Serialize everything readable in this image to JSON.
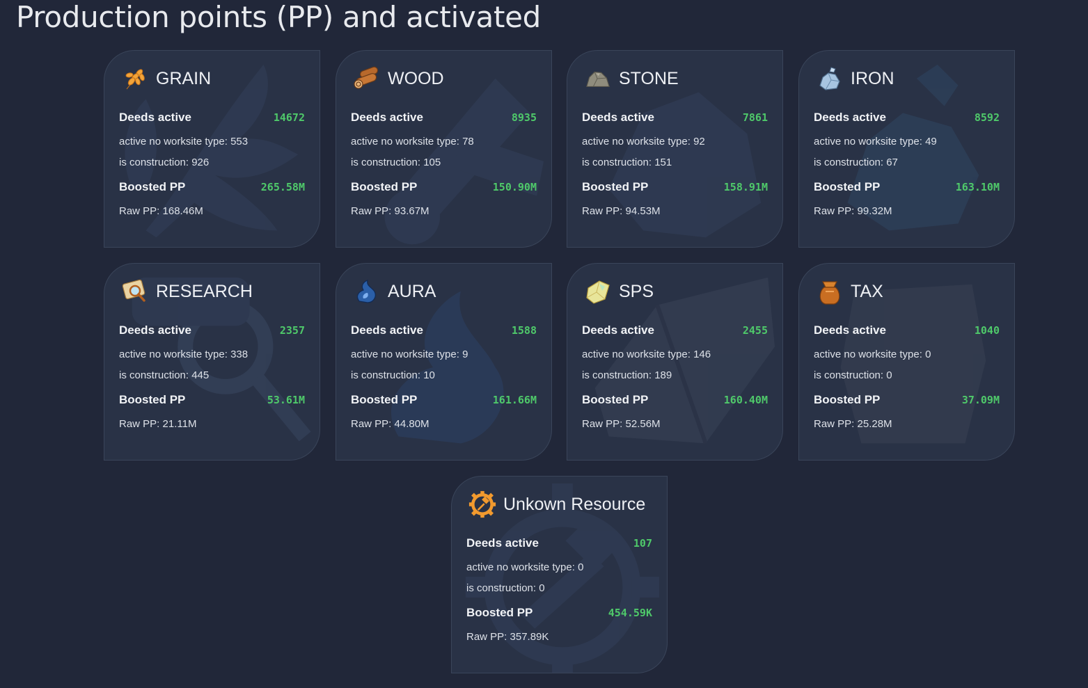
{
  "page": {
    "title": "Production points (PP) and activated"
  },
  "labels": {
    "deeds_active": "Deeds active",
    "boosted_pp": "Boosted PP"
  },
  "cards": [
    {
      "name": "GRAIN",
      "icon": "grain-icon",
      "deeds_active": "14672",
      "no_worksite": "active no worksite type: 553",
      "construction": "is construction: 926",
      "boosted_pp": "265.58M",
      "raw_pp": "Raw PP: 168.46M"
    },
    {
      "name": "WOOD",
      "icon": "wood-icon",
      "deeds_active": "8935",
      "no_worksite": "active no worksite type: 78",
      "construction": "is construction: 105",
      "boosted_pp": "150.90M",
      "raw_pp": "Raw PP: 93.67M"
    },
    {
      "name": "STONE",
      "icon": "stone-icon",
      "deeds_active": "7861",
      "no_worksite": "active no worksite type: 92",
      "construction": "is construction: 151",
      "boosted_pp": "158.91M",
      "raw_pp": "Raw PP: 94.53M"
    },
    {
      "name": "IRON",
      "icon": "iron-icon",
      "deeds_active": "8592",
      "no_worksite": "active no worksite type: 49",
      "construction": "is construction: 67",
      "boosted_pp": "163.10M",
      "raw_pp": "Raw PP: 99.32M"
    },
    {
      "name": "RESEARCH",
      "icon": "research-icon",
      "deeds_active": "2357",
      "no_worksite": "active no worksite type: 338",
      "construction": "is construction: 445",
      "boosted_pp": "53.61M",
      "raw_pp": "Raw PP: 21.11M"
    },
    {
      "name": "AURA",
      "icon": "aura-icon",
      "deeds_active": "1588",
      "no_worksite": "active no worksite type: 9",
      "construction": "is construction: 10",
      "boosted_pp": "161.66M",
      "raw_pp": "Raw PP: 44.80M"
    },
    {
      "name": "SPS",
      "icon": "sps-icon",
      "deeds_active": "2455",
      "no_worksite": "active no worksite type: 146",
      "construction": "is construction: 189",
      "boosted_pp": "160.40M",
      "raw_pp": "Raw PP: 52.56M"
    },
    {
      "name": "TAX",
      "icon": "tax-icon",
      "deeds_active": "1040",
      "no_worksite": "active no worksite type: 0",
      "construction": "is construction: 0",
      "boosted_pp": "37.09M",
      "raw_pp": "Raw PP: 25.28M"
    },
    {
      "name": "Unkown Resource",
      "icon": "gear-hammer-icon",
      "deeds_active": "107",
      "no_worksite": "active no worksite type: 0",
      "construction": "is construction: 0",
      "boosted_pp": "454.59K",
      "raw_pp": "Raw PP: 357.89K"
    }
  ]
}
